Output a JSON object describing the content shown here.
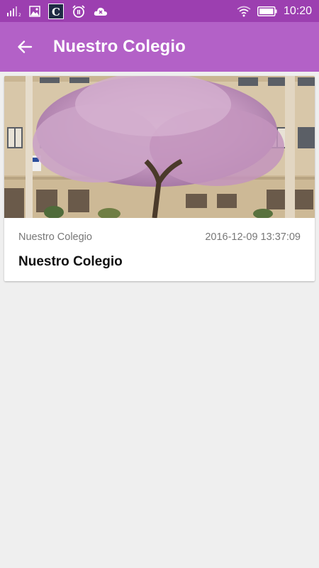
{
  "status_bar": {
    "time": "10:20",
    "icons": [
      "signal-icon",
      "gallery-icon",
      "app-c-icon",
      "alarm-icon",
      "cloud-icon",
      "wifi-icon",
      "battery-icon"
    ]
  },
  "app_bar": {
    "title": "Nuestro Colegio",
    "back_icon": "arrow-back-icon"
  },
  "card": {
    "category": "Nuestro Colegio",
    "timestamp": "2016-12-09 13:37:09",
    "title": "Nuestro Colegio",
    "image": "school-building-with-blossoming-tree"
  },
  "colors": {
    "status_bar": "#9c3fb0",
    "app_bar": "#b361c7",
    "background": "#efefef"
  }
}
